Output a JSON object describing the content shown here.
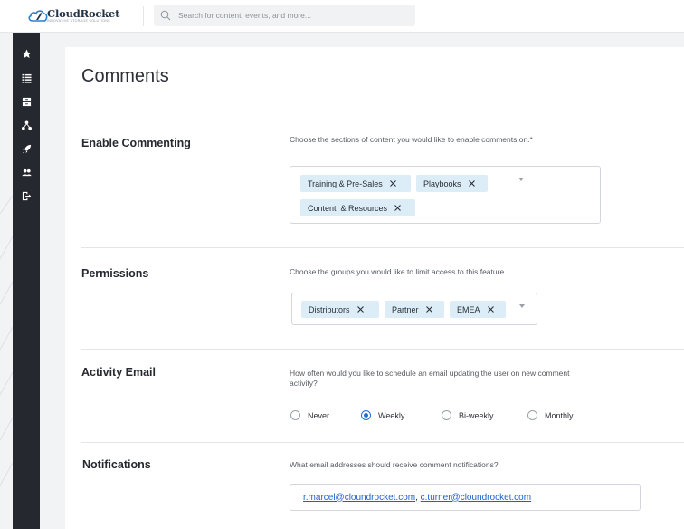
{
  "brand": {
    "name": "CloudRocket",
    "tagline": "INNOVATIVE STORAGE SOLUTIONS",
    "color": "#243447"
  },
  "search": {
    "placeholder": "Search for content, events, and more..."
  },
  "sidebar": {
    "background": "#25282e",
    "items": [
      {
        "icon": "star-icon"
      },
      {
        "icon": "list-icon"
      },
      {
        "icon": "archive-icon"
      },
      {
        "icon": "network-icon"
      },
      {
        "icon": "rocket-icon"
      },
      {
        "icon": "users-icon"
      },
      {
        "icon": "logout-icon"
      }
    ]
  },
  "page": {
    "title": "Comments"
  },
  "sections": {
    "commenting": {
      "label": "Enable Commenting",
      "hint": "Choose the sections of content you would like to enable comments on.*",
      "tags": [
        "Training & Pre-Sales",
        "Playbooks",
        "Content  & Resources"
      ]
    },
    "permissions": {
      "label": "Permissions",
      "hint": "Choose the groups you would like to limit access to this feature.",
      "tags": [
        "Distributors",
        "Partner",
        "EMEA"
      ]
    },
    "activity_email": {
      "label": "Activity Email",
      "hint": "How often would you like to schedule an email updating the user on new comment activity?",
      "options": [
        "Never",
        "Weekly",
        "Bi-weekly",
        "Monthly"
      ],
      "selected": "Weekly"
    },
    "notifications": {
      "label": "Notifications",
      "hint": "What email addresses should receive comment notifications?",
      "emails": [
        "r.marcel@cloundrocket.com",
        "c.turner@cloundrocket.com"
      ],
      "separator": ", "
    }
  },
  "colors": {
    "accent": "#1f6fe0",
    "tag_background": "#dcedf7",
    "link": "#1f5fcc"
  }
}
